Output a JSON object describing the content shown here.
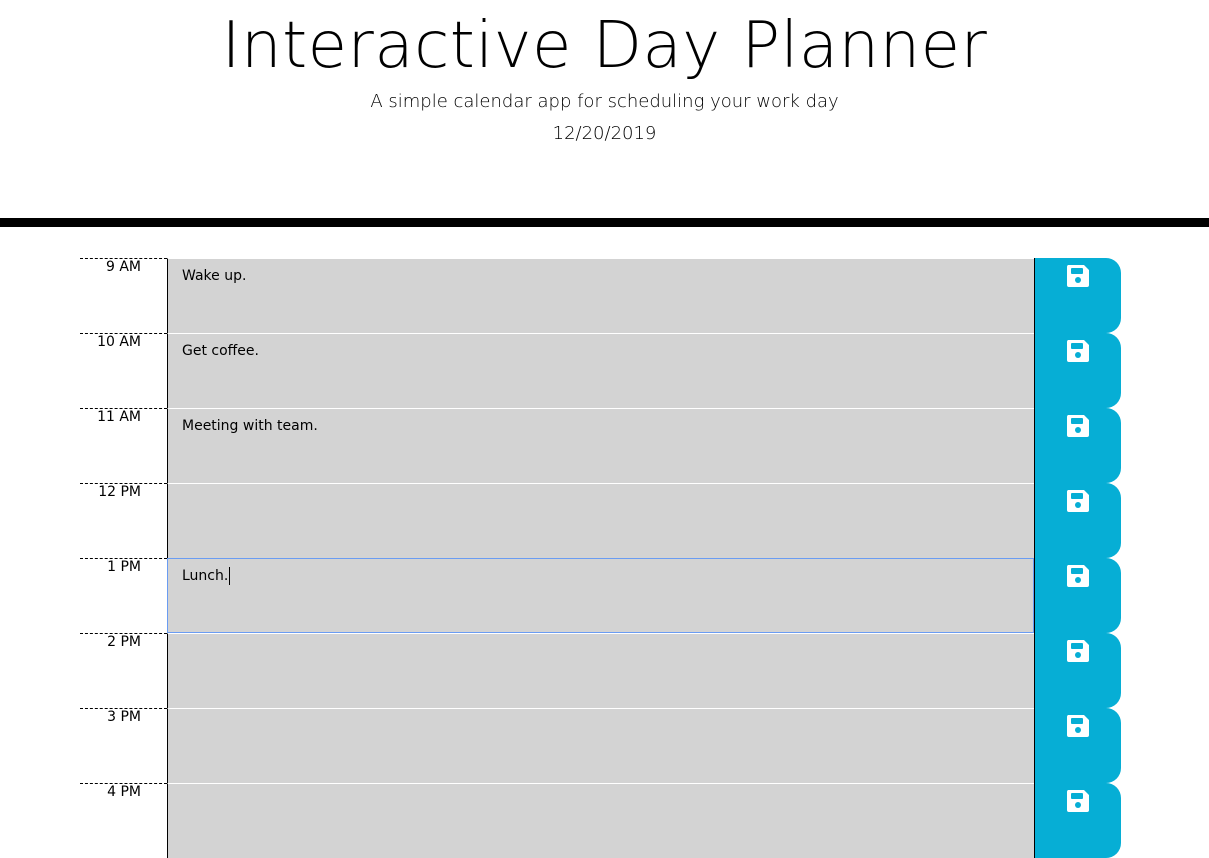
{
  "header": {
    "title": "Interactive Day Planner",
    "subtitle": "A simple calendar app for scheduling your work day",
    "date": "12/20/2019"
  },
  "colors": {
    "past": "#d3d3d3",
    "save_button": "#06aed5",
    "focus_outline": "#6a9cf2"
  },
  "icons": {
    "save": "floppy-disk-icon"
  },
  "planner": {
    "rows": [
      {
        "hour": "9 AM",
        "text": "Wake up."
      },
      {
        "hour": "10 AM",
        "text": "Get coffee."
      },
      {
        "hour": "11 AM",
        "text": "Meeting with team."
      },
      {
        "hour": "12 PM",
        "text": ""
      },
      {
        "hour": "1 PM",
        "text": "Lunch.",
        "focused": true
      },
      {
        "hour": "2 PM",
        "text": ""
      },
      {
        "hour": "3 PM",
        "text": ""
      },
      {
        "hour": "4 PM",
        "text": ""
      }
    ]
  }
}
